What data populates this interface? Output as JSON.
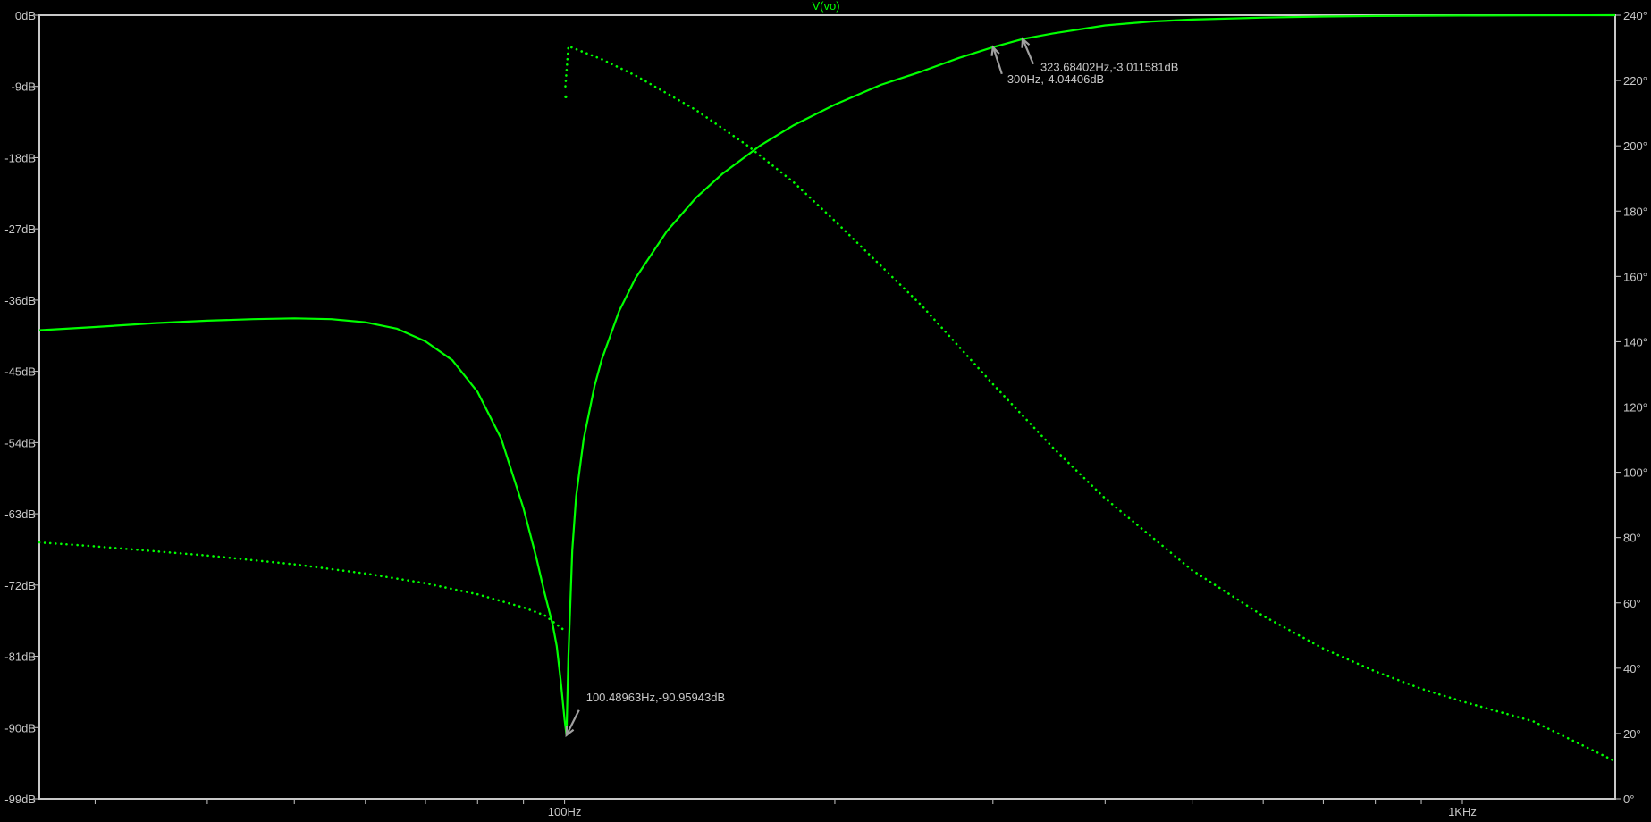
{
  "chart_data": {
    "type": "line",
    "title": "V(vo)",
    "x_scale": "log",
    "xlim": [
      26,
      1480
    ],
    "x_tick_labels": [
      {
        "value": 100,
        "label": "100Hz"
      },
      {
        "value": 1000,
        "label": "1KHz"
      }
    ],
    "y_left": {
      "ylim": [
        -99,
        0
      ],
      "ticks": [
        0,
        -9,
        -18,
        -27,
        -36,
        -45,
        -54,
        -63,
        -72,
        -81,
        -90,
        -99
      ],
      "tick_labels": [
        "0dB",
        "-9dB",
        "-18dB",
        "-27dB",
        "-36dB",
        "-45dB",
        "-54dB",
        "-63dB",
        "-72dB",
        "-81dB",
        "-90dB",
        "-99dB"
      ]
    },
    "y_right": {
      "ylim": [
        0,
        240
      ],
      "ticks": [
        240,
        220,
        200,
        180,
        160,
        140,
        120,
        100,
        80,
        60,
        40,
        20,
        0
      ],
      "tick_labels": [
        "240°",
        "220°",
        "200°",
        "180°",
        "160°",
        "140°",
        "120°",
        "100°",
        "80°",
        "60°",
        "40°",
        "20°",
        "0°"
      ]
    },
    "grid": false,
    "colors": {
      "trace": "#00ff00",
      "axis": "#c8c8c8",
      "cursor_arrow": "#a0a0a0",
      "background": "#000000"
    },
    "series": [
      {
        "style": "solid",
        "axis": "left",
        "x": [
          26,
          30,
          35,
          40,
          45,
          50,
          55,
          60,
          65,
          70,
          75,
          80,
          85,
          90,
          93,
          95,
          97,
          98,
          99,
          99.5,
          100,
          100.49,
          101,
          102,
          103,
          105,
          108,
          110,
          115,
          120,
          130,
          140,
          150,
          165,
          180,
          200,
          225,
          250,
          275,
          300,
          323.68,
          350,
          400,
          450,
          500,
          600,
          700,
          800,
          1000,
          1200,
          1480
        ],
        "y": [
          -39.8,
          -39.4,
          -38.9,
          -38.6,
          -38.4,
          -38.3,
          -38.4,
          -38.8,
          -39.6,
          -41.2,
          -43.6,
          -47.6,
          -53.5,
          -62.3,
          -68.5,
          -73,
          -77,
          -79.7,
          -84,
          -86.5,
          -89,
          -90.96,
          -81,
          -67.6,
          -60.8,
          -53.6,
          -46.8,
          -43.5,
          -37.4,
          -33.2,
          -27.3,
          -23.1,
          -20,
          -16.5,
          -13.9,
          -11.3,
          -8.8,
          -7.1,
          -5.4,
          -4.04,
          -3.01,
          -2.3,
          -1.3,
          -0.8,
          -0.55,
          -0.3,
          -0.17,
          -0.1,
          -0.05,
          -0.02,
          0
        ]
      },
      {
        "style": "dotted",
        "axis": "right",
        "x": [
          26,
          30,
          40,
          50,
          60,
          70,
          80,
          90,
          95,
          99.5,
          100.2,
          101,
          110,
          120,
          140,
          160,
          180,
          200,
          250,
          300,
          350,
          400,
          500,
          600,
          700,
          800,
          900,
          1000,
          1200,
          1480
        ],
        "y": [
          78.5,
          77.3,
          74.5,
          71.8,
          69,
          66,
          62.6,
          58.6,
          56.2,
          52,
          218.2,
          230.5,
          226.5,
          221.5,
          211,
          200,
          188.8,
          177,
          151,
          127,
          107.5,
          92,
          70,
          56,
          46,
          39,
          33.7,
          29.8,
          23.7,
          11.5
        ]
      }
    ],
    "annotations": [
      {
        "label": "100.48963Hz,-90.95943dB",
        "x": 100.48963,
        "y": -90.95943
      },
      {
        "label": "300Hz,-4.04406dB",
        "x": 300,
        "y": -4.04406
      },
      {
        "label": "323.68402Hz,-3.011581dB",
        "x": 323.68402,
        "y": -3.011581
      }
    ]
  }
}
